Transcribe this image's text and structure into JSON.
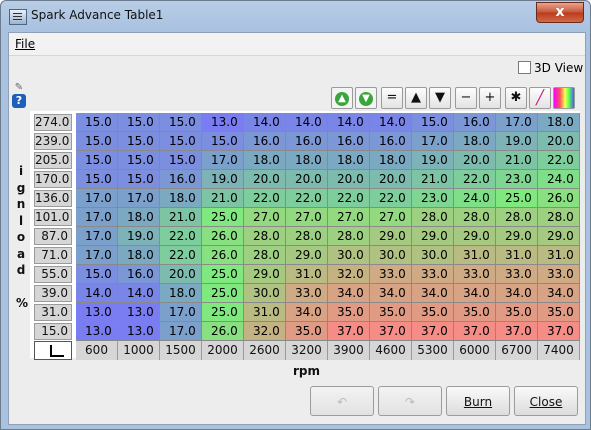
{
  "window": {
    "title": "Spark Advance Table1",
    "close_symbol": "x"
  },
  "menu": {
    "file": "File"
  },
  "view3d": {
    "label": "3D View",
    "checked": false
  },
  "help_symbol": "?",
  "y_axis": {
    "label_chars": [
      "i",
      "g",
      "n",
      "l",
      "o",
      "a",
      "d",
      "",
      "%"
    ],
    "values": [
      "274.0",
      "239.0",
      "205.0",
      "170.0",
      "136.0",
      "101.0",
      "87.0",
      "71.0",
      "55.0",
      "39.0",
      "31.0",
      "15.0"
    ]
  },
  "x_axis": {
    "label": "rpm",
    "values": [
      "600",
      "1000",
      "1500",
      "2000",
      "2600",
      "3200",
      "3900",
      "4600",
      "5300",
      "6000",
      "6700",
      "7400"
    ]
  },
  "toolbar": [
    "up-arrow-green",
    "down-arrow-green",
    "=",
    "▲",
    "▼",
    "−",
    "+",
    "✱",
    "pen",
    "gradient"
  ],
  "table": [
    [
      "15.0",
      "15.0",
      "15.0",
      "13.0",
      "14.0",
      "14.0",
      "14.0",
      "14.0",
      "15.0",
      "16.0",
      "17.0",
      "18.0"
    ],
    [
      "15.0",
      "15.0",
      "15.0",
      "15.0",
      "16.0",
      "16.0",
      "16.0",
      "16.0",
      "17.0",
      "18.0",
      "19.0",
      "20.0"
    ],
    [
      "15.0",
      "15.0",
      "15.0",
      "17.0",
      "18.0",
      "18.0",
      "18.0",
      "18.0",
      "19.0",
      "20.0",
      "21.0",
      "22.0"
    ],
    [
      "15.0",
      "15.0",
      "16.0",
      "19.0",
      "20.0",
      "20.0",
      "20.0",
      "20.0",
      "21.0",
      "22.0",
      "23.0",
      "24.0"
    ],
    [
      "17.0",
      "17.0",
      "18.0",
      "21.0",
      "22.0",
      "22.0",
      "22.0",
      "22.0",
      "23.0",
      "24.0",
      "25.0",
      "26.0"
    ],
    [
      "17.0",
      "18.0",
      "21.0",
      "25.0",
      "27.0",
      "27.0",
      "27.0",
      "27.0",
      "28.0",
      "28.0",
      "28.0",
      "28.0"
    ],
    [
      "17.0",
      "19.0",
      "22.0",
      "26.0",
      "28.0",
      "28.0",
      "28.0",
      "29.0",
      "29.0",
      "29.0",
      "29.0",
      "29.0"
    ],
    [
      "17.0",
      "18.0",
      "22.0",
      "26.0",
      "28.0",
      "29.0",
      "30.0",
      "30.0",
      "30.0",
      "31.0",
      "31.0",
      "31.0"
    ],
    [
      "15.0",
      "16.0",
      "20.0",
      "25.0",
      "29.0",
      "31.0",
      "32.0",
      "33.0",
      "33.0",
      "33.0",
      "33.0",
      "33.0"
    ],
    [
      "14.0",
      "14.0",
      "18.0",
      "25.0",
      "30.0",
      "33.0",
      "34.0",
      "34.0",
      "34.0",
      "34.0",
      "34.0",
      "34.0"
    ],
    [
      "13.0",
      "13.0",
      "17.0",
      "25.0",
      "31.0",
      "34.0",
      "35.0",
      "35.0",
      "35.0",
      "35.0",
      "35.0",
      "35.0"
    ],
    [
      "13.0",
      "13.0",
      "17.0",
      "26.0",
      "32.0",
      "35.0",
      "37.0",
      "37.0",
      "37.0",
      "37.0",
      "37.0",
      "37.0"
    ]
  ],
  "buttons": {
    "undo": "↶",
    "redo": "↷",
    "burn": "Burn",
    "close": "Close"
  },
  "colors": {
    "low": "#7a7cf2",
    "mid": "#7fe87f",
    "high": "#f58c86"
  }
}
